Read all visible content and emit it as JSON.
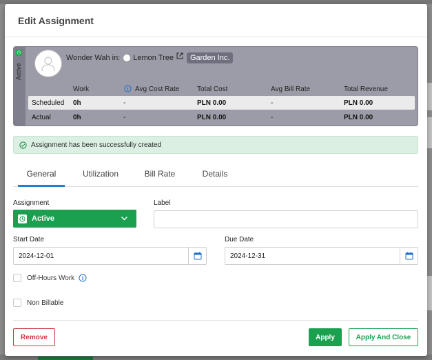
{
  "modal": {
    "title": "Edit Assignment"
  },
  "card": {
    "status_label": "Active",
    "resource_name": "Wonder Wah in:",
    "project_name": "Lemon Tree",
    "client_name": "Garden Inc.",
    "columns": {
      "work": "Work",
      "avg_cost_rate": "Avg Cost Rate",
      "total_cost": "Total Cost",
      "avg_bill_rate": "Avg Bill Rate",
      "total_revenue": "Total Revenue"
    },
    "rows": {
      "scheduled": {
        "label": "Scheduled",
        "work": "0h",
        "avg_cost_rate": "-",
        "total_cost": "PLN 0.00",
        "avg_bill_rate": "-",
        "total_revenue": "PLN 0.00"
      },
      "actual": {
        "label": "Actual",
        "work": "0h",
        "avg_cost_rate": "-",
        "total_cost": "PLN 0.00",
        "avg_bill_rate": "-",
        "total_revenue": "PLN 0.00"
      }
    }
  },
  "alert": {
    "message": "Assignment has been successfully created"
  },
  "tabs": [
    {
      "label": "General",
      "active": true
    },
    {
      "label": "Utilization",
      "active": false
    },
    {
      "label": "Bill Rate",
      "active": false
    },
    {
      "label": "Details",
      "active": false
    }
  ],
  "form": {
    "assignment_label": "Assignment",
    "assignment_value": "Active",
    "label_label": "Label",
    "label_value": "",
    "start_date_label": "Start Date",
    "start_date_value": "2024-12-01",
    "due_date_label": "Due Date",
    "due_date_value": "2024-12-31",
    "off_hours_label": "Off-Hours Work",
    "non_billable_label": "Non Billable"
  },
  "footer": {
    "remove_label": "Remove",
    "apply_label": "Apply",
    "apply_close_label": "Apply And Close"
  },
  "colors": {
    "accent_green": "#1ba050",
    "danger_red": "#c9393f",
    "tab_blue": "#1c7ed6",
    "card_bg": "#9c9ca8"
  }
}
